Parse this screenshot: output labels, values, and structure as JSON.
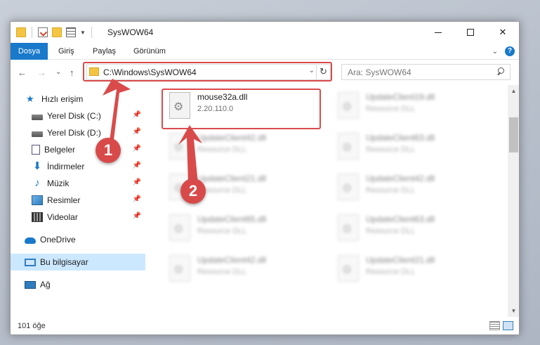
{
  "window": {
    "title": "SysWOW64",
    "controls": {
      "minimize": "—",
      "maximize": "☐",
      "close": "✕"
    }
  },
  "ribbon": {
    "tabs": [
      "Dosya",
      "Giriş",
      "Paylaş",
      "Görünüm"
    ],
    "expand": "⌄",
    "help": "?"
  },
  "nav": {
    "back": "←",
    "forward": "→",
    "recent": "⌄",
    "up": "↑",
    "address": "C:\\Windows\\SysWOW64",
    "address_dropdown": "⌄",
    "refresh": "↻",
    "search_placeholder": "Ara: SysWOW64"
  },
  "sidebar": {
    "items": [
      {
        "label": "Hızlı erişim",
        "icon": "star-icon"
      },
      {
        "label": "Yerel Disk (C:)",
        "icon": "disk-icon",
        "pinned": true
      },
      {
        "label": "Yerel Disk (D:)",
        "icon": "disk-icon",
        "pinned": true
      },
      {
        "label": "Belgeler",
        "icon": "document-icon",
        "pinned": true
      },
      {
        "label": "İndirmeler",
        "icon": "download-icon",
        "pinned": true
      },
      {
        "label": "Müzik",
        "icon": "music-icon",
        "pinned": true
      },
      {
        "label": "Resimler",
        "icon": "pictures-icon",
        "pinned": true
      },
      {
        "label": "Videolar",
        "icon": "videos-icon",
        "pinned": true
      },
      {
        "label": "OneDrive",
        "icon": "cloud-icon"
      },
      {
        "label": "Bu bilgisayar",
        "icon": "computer-icon",
        "selected": true
      },
      {
        "label": "Ağ",
        "icon": "network-icon"
      }
    ],
    "pin_glyph": "📌"
  },
  "files": [
    {
      "name": "mouse32a.dll",
      "sub": "2.20.110.0",
      "highlighted": true
    },
    {
      "name": "UpdateClient19.dll",
      "sub": "Resource DLL"
    },
    {
      "name": "UpdateClient42.dll",
      "sub": "Resource DLL"
    },
    {
      "name": "UpdateClient63.dll",
      "sub": "Resource DLL"
    },
    {
      "name": "UpdateClient21.dll",
      "sub": "Resource DLL"
    },
    {
      "name": "UpdateClient42.dll",
      "sub": "Resource DLL"
    },
    {
      "name": "UpdateClient65.dll",
      "sub": "Resource DLL"
    },
    {
      "name": "UpdateClient63.dll",
      "sub": "Resource DLL"
    },
    {
      "name": "UpdateClient42.dll",
      "sub": "Resource DLL"
    },
    {
      "name": "UpdateClient21.dll",
      "sub": "Resource DLL"
    }
  ],
  "status": {
    "count": "101 öğe"
  },
  "annotations": {
    "markers": [
      "1",
      "2"
    ],
    "color": "#d94b4b"
  },
  "colors": {
    "accent": "#1979ca",
    "selected": "#cce8ff"
  }
}
